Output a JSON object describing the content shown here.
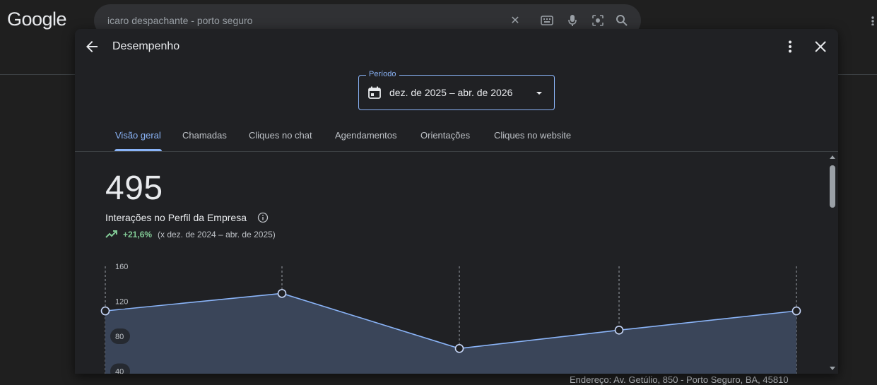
{
  "background": {
    "logo": "Google",
    "search": {
      "query": "icaro despachante - porto seguro"
    },
    "bottom_text": "Endereço: Av. Getúlio, 850 - Porto Seguro, BA, 45810"
  },
  "modal": {
    "title": "Desempenho",
    "period": {
      "label": "Período",
      "value": "dez. de 2025 – abr. de 2026"
    },
    "tabs": [
      {
        "label": "Visão geral",
        "active": true
      },
      {
        "label": "Chamadas"
      },
      {
        "label": "Cliques no chat"
      },
      {
        "label": "Agendamentos"
      },
      {
        "label": "Orientações"
      },
      {
        "label": "Cliques no website"
      }
    ],
    "metric": {
      "value": "495",
      "label": "Interações no Perfil da Empresa",
      "trend": "+21,6%",
      "comparison": "(x dez. de 2024 – abr. de 2025)"
    }
  },
  "colors": {
    "accent": "#8ab4f8",
    "positive": "#81c995",
    "area_fill": "#3a4559"
  },
  "chart_data": {
    "type": "area",
    "y_ticks": [
      "160",
      "120",
      "80",
      "40"
    ],
    "ylim": [
      0,
      160
    ],
    "values": [
      109,
      129,
      66,
      87,
      109
    ]
  }
}
